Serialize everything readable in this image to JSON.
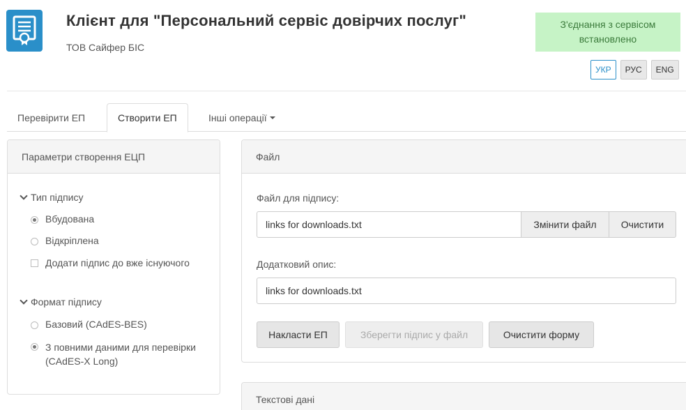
{
  "header": {
    "title": "Клієнт для \"Персональний сервіс довірчих послуг\"",
    "company": "ТОВ Сайфер БІС",
    "status": "З'єднання з сервісом встановлено",
    "languages": [
      "УКР",
      "РУС",
      "ENG"
    ],
    "active_language": "УКР"
  },
  "tabs": [
    {
      "label": "Перевірити ЕП"
    },
    {
      "label": "Створити ЕП"
    },
    {
      "label": "Інші операції"
    }
  ],
  "params_panel": {
    "title": "Параметри створення ЕЦП",
    "signature_type": {
      "label": "Тип підпису",
      "options": [
        "Вбудована",
        "Відкріплена"
      ],
      "selected": "Вбудована",
      "checkbox": "Додати підпис до вже існуючого"
    },
    "signature_format": {
      "label": "Формат підпису",
      "options": [
        "Базовий (CAdES-BES)",
        "З повними даними для перевірки (CAdES-X Long)"
      ],
      "selected": "З повними даними для перевірки (CAdES-X Long)"
    }
  },
  "file_panel": {
    "title": "Файл",
    "file_label": "Файл для підпису:",
    "file_value": "links for downloads.txt",
    "change_file": "Змінити файл",
    "clear": "Очистити",
    "desc_label": "Додатковий опис:",
    "desc_value": "links for downloads.txt",
    "sign_button": "Накласти ЕП",
    "save_button": "Зберегти підпис у файл",
    "clear_form_button": "Очистити форму"
  },
  "text_panel": {
    "title": "Текстові дані"
  },
  "colors": {
    "logo": "#2a8fc9",
    "status_bg": "#c6f3c6",
    "status_text": "#3a7a3a"
  }
}
